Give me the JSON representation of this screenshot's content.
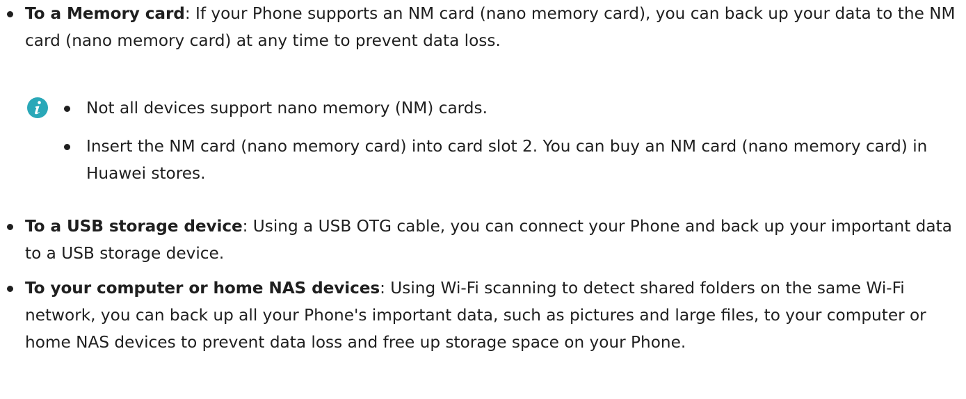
{
  "items": [
    {
      "title": "To a Memory card",
      "text": ": If your Phone supports an NM card (nano memory card), you can back up your data to the NM card (nano memory card) at any time to prevent data loss."
    },
    {
      "title": "To a USB storage device",
      "text": ": Using a USB OTG cable, you can connect your Phone and back up your important data to a USB storage device."
    },
    {
      "title": "To your computer or home NAS devices",
      "text": ": Using Wi-Fi scanning to detect shared folders on the same Wi-Fi network, you can back up all your Phone's important data, such as pictures and large files, to your computer or home NAS devices to prevent data loss and free up storage space on your Phone."
    }
  ],
  "note": {
    "icon": "info-icon",
    "items": [
      "Not all devices support nano memory (NM) cards.",
      "Insert the NM card (nano memory card) into card slot 2. You can buy an NM card (nano memory card) in Huawei stores."
    ]
  },
  "colors": {
    "text": "#1f1f1f",
    "info_icon": "#2aa8b8"
  }
}
